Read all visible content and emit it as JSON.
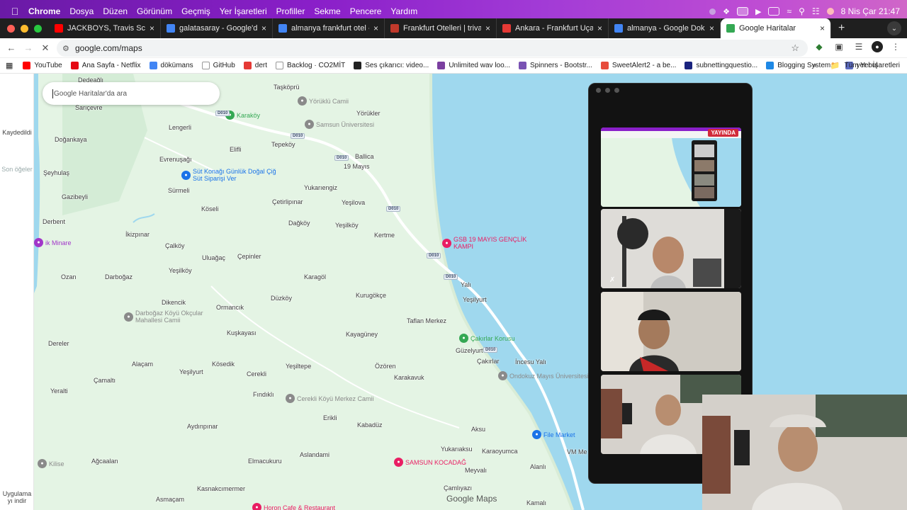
{
  "menubar": {
    "app": "Chrome",
    "items": [
      "Dosya",
      "Düzen",
      "Görünüm",
      "Geçmiş",
      "Yer İşaretleri",
      "Profiller",
      "Sekme",
      "Pencere",
      "Yardım"
    ],
    "datetime": "8 Nis Çar  21:47"
  },
  "tabs": [
    {
      "title": "JACKBOYS, Travis Scott - Wh",
      "favicon": "youtube-icon",
      "color": "#ff0000"
    },
    {
      "title": "galatasaray - Google'da Ara",
      "favicon": "google-icon",
      "color": "#4285f4"
    },
    {
      "title": "almanya frankfurt otel - Goog",
      "favicon": "google-icon",
      "color": "#4285f4"
    },
    {
      "title": "Frankfurt Otelleri | trivago'da",
      "favicon": "trivago-icon",
      "color": "#c0392b"
    },
    {
      "title": "Ankara - Frankfurt Uçak Sefe",
      "favicon": "obilet-icon",
      "color": "#e53935"
    },
    {
      "title": "almanya - Google Dokümanlar",
      "favicon": "docs-icon",
      "color": "#4285f4"
    },
    {
      "title": "Google Haritalar",
      "favicon": "maps-icon",
      "color": "#34a853",
      "active": true
    }
  ],
  "toolbar": {
    "url": "google.com/maps"
  },
  "bookmarks": [
    {
      "label": "YouTube",
      "color": "#ff0000",
      "icon": "youtube-icon"
    },
    {
      "label": "Ana Sayfa - Netflix",
      "color": "#e50914",
      "icon": "netflix-icon"
    },
    {
      "label": "dökümans",
      "color": "#4285f4",
      "icon": "docs-icon"
    },
    {
      "label": "GitHub",
      "color": "#ffffff",
      "icon": "github-icon"
    },
    {
      "label": "dert",
      "color": "#e53935",
      "icon": "dert-icon"
    },
    {
      "label": "Backlog · CO2MİT",
      "color": "#ffffff",
      "icon": "backlog-icon"
    },
    {
      "label": "Ses çıkarıcı: video...",
      "color": "#222222",
      "icon": "audio-icon"
    },
    {
      "label": "Unlimited wav loo...",
      "color": "#7b3fa0",
      "icon": "wav-icon"
    },
    {
      "label": "Spinners - Bootstr...",
      "color": "#7952b3",
      "icon": "bootstrap-icon"
    },
    {
      "label": "SweetAlert2 - a be...",
      "color": "#e74c3c",
      "icon": "sweetalert-icon"
    },
    {
      "label": "subnettingquestio...",
      "color": "#1a237e",
      "icon": "subnet-icon"
    },
    {
      "label": "Blogging System...",
      "color": "#1e88e5",
      "icon": "blog-icon"
    },
    {
      "label": "yer bul",
      "color": "#5c6bc0",
      "icon": "yerbul-icon"
    }
  ],
  "bookmarks_all": "Tüm Yer İşaretleri",
  "sidebar": {
    "saved": "Kaydedildi",
    "recent": "Son öğeler",
    "download": "Uygulama yı indir"
  },
  "search": {
    "placeholder": "Google Haritalar'da ara"
  },
  "map_places": [
    "Dedeağlı",
    "Taşköprü",
    "Yörüklü Camii",
    "Sarıçevre",
    "Karaköy",
    "Yörükler",
    "Lengerli",
    "Samsun Üniversitesi",
    "Doğankaya",
    "Elifli",
    "Tepeköy",
    "Ballica",
    "Evrenuşağı",
    "19 Mayıs",
    "Şeyhulaş",
    "Süt Konağı Günlük Doğal Çiğ Süt Siparişi Ver",
    "Sürmeli",
    "Yukarıengiz",
    "Gazibeyli",
    "Çetirlipınar",
    "Yeşilova",
    "Köseli",
    "Derbent",
    "Dağköy",
    "Yeşilköy",
    "Kertme",
    "İkizpınar",
    "GSB 19 MAYIS GENÇLİK KAMPI",
    "ik Minare",
    "Çalköy",
    "Uluağaç",
    "Çepinler",
    "Yeşilköy",
    "Ozan",
    "Darboğaz",
    "Karagöl",
    "Yalı",
    "Düzköy",
    "Kurugökçe",
    "Dikencik",
    "Ormancık",
    "Yeşilyurt",
    "Darboğaz Köyü Okçular Mahallesi Camii",
    "Taflan Merkez",
    "Kuşkayası",
    "Kayagüney",
    "Çakırlar Korusu",
    "Dereler",
    "Güzelyurt",
    "Alaçam",
    "Kösedik",
    "Yeşiltepe",
    "Özören",
    "Çakırlar",
    "İncesu Yalı",
    "Çamaltı",
    "Yeşilyurt",
    "Cerekli",
    "Karakavuk",
    "Ondokuz Mayıs Üniversitesi",
    "Yeralti",
    "Fındıklı",
    "Cerekli Köyü Merkez Camii",
    "Erikli",
    "Kabadüz",
    "Aydınpınar",
    "Aksu",
    "File Market",
    "Kilise",
    "Ağcaalan",
    "Aslandami",
    "SAMSUN KOCADAĞ",
    "Yukarıaksu",
    "Karaoyumca",
    "Elmacukuru",
    "Meyvalı",
    "Alanlı",
    "Çamlıyazı",
    "Kasnakcımermer",
    "Asmaçam",
    "Kamalı",
    "Horon Cafe & Restaurant",
    "VM Me"
  ],
  "roads": [
    "D010"
  ],
  "map_brand": "Google Maps",
  "meeting": {
    "live_badge": "YAYINDA"
  },
  "colors": {
    "land": "#e4f4e4",
    "sea": "#9fd8ee",
    "road": "#ffffff",
    "accent": "#a236c9"
  }
}
